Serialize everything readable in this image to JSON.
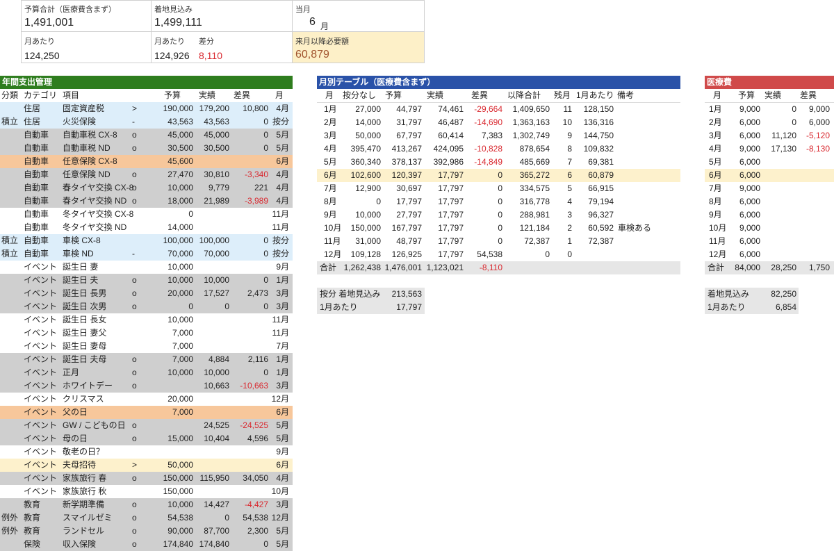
{
  "summary": {
    "budget_label": "予算合計（医療費含まず）",
    "budget_value": "1,491,001",
    "expected_label": "着地見込み",
    "expected_value": "1,499,111",
    "month_label": "当月",
    "month_value": "6",
    "month_unit": "月",
    "per_month_label": "月あたり",
    "per_month_value": "124,250",
    "per_month_label2": "月あたり",
    "diff_label": "差分",
    "per_month_value2": "124,926",
    "diff_value": "8,110",
    "next_label": "来月以降必要額",
    "next_value": "60,879"
  },
  "annual": {
    "title": "年間支出管理",
    "headers": [
      "分類",
      "カテゴリ",
      "項目",
      "",
      "予算",
      "実績",
      "差異",
      "月"
    ],
    "rows": [
      {
        "bg": "blue",
        "cls": "",
        "cat": "住居",
        "item": "固定資産税",
        "flag": ">",
        "budget": "190,000",
        "actual": "179,200",
        "diff": "10,800",
        "month": "4月",
        "neg": false
      },
      {
        "bg": "blue",
        "cls": "積立",
        "cat": "住居",
        "item": "火災保険",
        "flag": "-",
        "budget": "43,563",
        "actual": "43,563",
        "diff": "0",
        "month": "按分",
        "neg": false
      },
      {
        "bg": "gray",
        "cls": "",
        "cat": "自動車",
        "item": "自動車税 CX-8",
        "flag": "o",
        "budget": "45,000",
        "actual": "45,000",
        "diff": "0",
        "month": "5月",
        "neg": false
      },
      {
        "bg": "gray",
        "cls": "",
        "cat": "自動車",
        "item": "自動車税 ND",
        "flag": "o",
        "budget": "30,500",
        "actual": "30,500",
        "diff": "0",
        "month": "5月",
        "neg": false
      },
      {
        "bg": "orange",
        "cls": "",
        "cat": "自動車",
        "item": "任意保険 CX-8",
        "flag": "",
        "budget": "45,600",
        "actual": "",
        "diff": "",
        "month": "6月",
        "neg": false
      },
      {
        "bg": "gray",
        "cls": "",
        "cat": "自動車",
        "item": "任意保険 ND",
        "flag": "o",
        "budget": "27,470",
        "actual": "30,810",
        "diff": "-3,340",
        "month": "4月",
        "neg": true
      },
      {
        "bg": "gray",
        "cls": "",
        "cat": "自動車",
        "item": "春タイヤ交換 CX-8",
        "flag": "o",
        "budget": "10,000",
        "actual": "9,779",
        "diff": "221",
        "month": "4月",
        "neg": false
      },
      {
        "bg": "gray",
        "cls": "",
        "cat": "自動車",
        "item": "春タイヤ交換 ND",
        "flag": "o",
        "budget": "18,000",
        "actual": "21,989",
        "diff": "-3,989",
        "month": "4月",
        "neg": true
      },
      {
        "bg": "white",
        "cls": "",
        "cat": "自動車",
        "item": "冬タイヤ交換 CX-8",
        "flag": "",
        "budget": "0",
        "actual": "",
        "diff": "",
        "month": "11月",
        "neg": false
      },
      {
        "bg": "white",
        "cls": "",
        "cat": "自動車",
        "item": "冬タイヤ交換 ND",
        "flag": "",
        "budget": "14,000",
        "actual": "",
        "diff": "",
        "month": "11月",
        "neg": false
      },
      {
        "bg": "blue",
        "cls": "積立",
        "cat": "自動車",
        "item": "車検 CX-8",
        "flag": "",
        "budget": "100,000",
        "actual": "100,000",
        "diff": "0",
        "month": "按分",
        "neg": false
      },
      {
        "bg": "blue",
        "cls": "積立",
        "cat": "自動車",
        "item": "車検 ND",
        "flag": "-",
        "budget": "70,000",
        "actual": "70,000",
        "diff": "0",
        "month": "按分",
        "neg": false
      },
      {
        "bg": "white",
        "cls": "",
        "cat": "イベント",
        "item": "誕生日 妻",
        "flag": "",
        "budget": "10,000",
        "actual": "",
        "diff": "",
        "month": "9月",
        "neg": false
      },
      {
        "bg": "gray",
        "cls": "",
        "cat": "イベント",
        "item": "誕生日 夫",
        "flag": "o",
        "budget": "10,000",
        "actual": "10,000",
        "diff": "0",
        "month": "1月",
        "neg": false
      },
      {
        "bg": "gray",
        "cls": "",
        "cat": "イベント",
        "item": "誕生日 長男",
        "flag": "o",
        "budget": "20,000",
        "actual": "17,527",
        "diff": "2,473",
        "month": "3月",
        "neg": false
      },
      {
        "bg": "gray",
        "cls": "",
        "cat": "イベント",
        "item": "誕生日 次男",
        "flag": "o",
        "budget": "0",
        "actual": "0",
        "diff": "0",
        "month": "3月",
        "neg": false
      },
      {
        "bg": "white",
        "cls": "",
        "cat": "イベント",
        "item": "誕生日 長女",
        "flag": "",
        "budget": "10,000",
        "actual": "",
        "diff": "",
        "month": "11月",
        "neg": false
      },
      {
        "bg": "white",
        "cls": "",
        "cat": "イベント",
        "item": "誕生日 妻父",
        "flag": "",
        "budget": "7,000",
        "actual": "",
        "diff": "",
        "month": "11月",
        "neg": false
      },
      {
        "bg": "white",
        "cls": "",
        "cat": "イベント",
        "item": "誕生日 妻母",
        "flag": "",
        "budget": "7,000",
        "actual": "",
        "diff": "",
        "month": "7月",
        "neg": false
      },
      {
        "bg": "gray",
        "cls": "",
        "cat": "イベント",
        "item": "誕生日 夫母",
        "flag": "o",
        "budget": "7,000",
        "actual": "4,884",
        "diff": "2,116",
        "month": "1月",
        "neg": false
      },
      {
        "bg": "gray",
        "cls": "",
        "cat": "イベント",
        "item": "正月",
        "flag": "o",
        "budget": "10,000",
        "actual": "10,000",
        "diff": "0",
        "month": "1月",
        "neg": false
      },
      {
        "bg": "gray",
        "cls": "",
        "cat": "イベント",
        "item": "ホワイトデー",
        "flag": "o",
        "budget": "",
        "actual": "10,663",
        "diff": "-10,663",
        "month": "3月",
        "neg": true
      },
      {
        "bg": "white",
        "cls": "",
        "cat": "イベント",
        "item": "クリスマス",
        "flag": "",
        "budget": "20,000",
        "actual": "",
        "diff": "",
        "month": "12月",
        "neg": false
      },
      {
        "bg": "orange",
        "cls": "",
        "cat": "イベント",
        "item": "父の日",
        "flag": "",
        "budget": "7,000",
        "actual": "",
        "diff": "",
        "month": "6月",
        "neg": false
      },
      {
        "bg": "gray",
        "cls": "",
        "cat": "イベント",
        "item": "GW / こどもの日",
        "flag": "o",
        "budget": "",
        "actual": "24,525",
        "diff": "-24,525",
        "month": "5月",
        "neg": true
      },
      {
        "bg": "gray",
        "cls": "",
        "cat": "イベント",
        "item": "母の日",
        "flag": "o",
        "budget": "15,000",
        "actual": "10,404",
        "diff": "4,596",
        "month": "5月",
        "neg": false
      },
      {
        "bg": "white",
        "cls": "",
        "cat": "イベント",
        "item": "敬老の日？",
        "flag": "",
        "budget": "",
        "actual": "",
        "diff": "",
        "month": "9月",
        "neg": false
      },
      {
        "bg": "yellow",
        "cls": "",
        "cat": "イベント",
        "item": "夫母招待",
        "flag": ">",
        "budget": "50,000",
        "actual": "",
        "diff": "",
        "month": "6月",
        "neg": false
      },
      {
        "bg": "gray",
        "cls": "",
        "cat": "イベント",
        "item": "家族旅行 春",
        "flag": "o",
        "budget": "150,000",
        "actual": "115,950",
        "diff": "34,050",
        "month": "4月",
        "neg": false
      },
      {
        "bg": "white",
        "cls": "",
        "cat": "イベント",
        "item": "家族旅行 秋",
        "flag": "",
        "budget": "150,000",
        "actual": "",
        "diff": "",
        "month": "10月",
        "neg": false
      },
      {
        "bg": "gray",
        "cls": "",
        "cat": "教育",
        "item": "新学期準備",
        "flag": "o",
        "budget": "10,000",
        "actual": "14,427",
        "diff": "-4,427",
        "month": "3月",
        "neg": true
      },
      {
        "bg": "gray",
        "cls": "例外",
        "cat": "教育",
        "item": "スマイルゼミ",
        "flag": "o",
        "budget": "54,538",
        "actual": "0",
        "diff": "54,538",
        "month": "12月",
        "neg": false
      },
      {
        "bg": "gray",
        "cls": "例外",
        "cat": "教育",
        "item": "ランドセル",
        "flag": "o",
        "budget": "90,000",
        "actual": "87,700",
        "diff": "2,300",
        "month": "5月",
        "neg": false
      },
      {
        "bg": "gray",
        "cls": "",
        "cat": "保険",
        "item": "収入保険",
        "flag": "o",
        "budget": "174,840",
        "actual": "174,840",
        "diff": "0",
        "month": "5月",
        "neg": false
      }
    ]
  },
  "monthly": {
    "title": "月別テーブル（医療費含まず）",
    "headers": [
      "月",
      "按分なし",
      "予算",
      "実績",
      "差異",
      "以降合計",
      "残月",
      "1月あたり",
      "備考"
    ],
    "rows": [
      {
        "hl": false,
        "m": "1月",
        "a": "27,000",
        "b": "44,797",
        "c": "74,461",
        "d": "-29,664",
        "e": "1,409,650",
        "f": "11",
        "g": "128,150",
        "h": "",
        "neg": true
      },
      {
        "hl": false,
        "m": "2月",
        "a": "14,000",
        "b": "31,797",
        "c": "46,487",
        "d": "-14,690",
        "e": "1,363,163",
        "f": "10",
        "g": "136,316",
        "h": "",
        "neg": true
      },
      {
        "hl": false,
        "m": "3月",
        "a": "50,000",
        "b": "67,797",
        "c": "60,414",
        "d": "7,383",
        "e": "1,302,749",
        "f": "9",
        "g": "144,750",
        "h": "",
        "neg": false
      },
      {
        "hl": false,
        "m": "4月",
        "a": "395,470",
        "b": "413,267",
        "c": "424,095",
        "d": "-10,828",
        "e": "878,654",
        "f": "8",
        "g": "109,832",
        "h": "",
        "neg": true
      },
      {
        "hl": false,
        "m": "5月",
        "a": "360,340",
        "b": "378,137",
        "c": "392,986",
        "d": "-14,849",
        "e": "485,669",
        "f": "7",
        "g": "69,381",
        "h": "",
        "neg": true
      },
      {
        "hl": true,
        "m": "6月",
        "a": "102,600",
        "b": "120,397",
        "c": "17,797",
        "d": "0",
        "e": "365,272",
        "f": "6",
        "g": "60,879",
        "h": "",
        "neg": false
      },
      {
        "hl": false,
        "m": "7月",
        "a": "12,900",
        "b": "30,697",
        "c": "17,797",
        "d": "0",
        "e": "334,575",
        "f": "5",
        "g": "66,915",
        "h": "",
        "neg": false
      },
      {
        "hl": false,
        "m": "8月",
        "a": "0",
        "b": "17,797",
        "c": "17,797",
        "d": "0",
        "e": "316,778",
        "f": "4",
        "g": "79,194",
        "h": "",
        "neg": false
      },
      {
        "hl": false,
        "m": "9月",
        "a": "10,000",
        "b": "27,797",
        "c": "17,797",
        "d": "0",
        "e": "288,981",
        "f": "3",
        "g": "96,327",
        "h": "",
        "neg": false
      },
      {
        "hl": false,
        "m": "10月",
        "a": "150,000",
        "b": "167,797",
        "c": "17,797",
        "d": "0",
        "e": "121,184",
        "f": "2",
        "g": "60,592",
        "h": "車検ある",
        "neg": false
      },
      {
        "hl": false,
        "m": "11月",
        "a": "31,000",
        "b": "48,797",
        "c": "17,797",
        "d": "0",
        "e": "72,387",
        "f": "1",
        "g": "72,387",
        "h": "",
        "neg": false
      },
      {
        "hl": false,
        "m": "12月",
        "a": "109,128",
        "b": "126,925",
        "c": "17,797",
        "d": "54,538",
        "e": "0",
        "f": "0",
        "g": "",
        "h": "",
        "neg": false
      }
    ],
    "total": {
      "label": "合計",
      "a": "1,262,438",
      "b": "1,476,001",
      "c": "1,123,021",
      "d": "-8,110"
    },
    "footer": [
      {
        "label": "按分 着地見込み",
        "value": "213,563"
      },
      {
        "label": "1月あたり",
        "value": "17,797"
      }
    ]
  },
  "medical": {
    "title": "医療費",
    "headers": [
      "月",
      "予算",
      "実績",
      "差異"
    ],
    "rows": [
      {
        "hl": false,
        "m": "1月",
        "a": "9,000",
        "b": "0",
        "c": "9,000",
        "neg": false
      },
      {
        "hl": false,
        "m": "2月",
        "a": "6,000",
        "b": "0",
        "c": "6,000",
        "neg": false
      },
      {
        "hl": false,
        "m": "3月",
        "a": "6,000",
        "b": "11,120",
        "c": "-5,120",
        "neg": true
      },
      {
        "hl": false,
        "m": "4月",
        "a": "9,000",
        "b": "17,130",
        "c": "-8,130",
        "neg": true
      },
      {
        "hl": false,
        "m": "5月",
        "a": "6,000",
        "b": "",
        "c": "",
        "neg": false
      },
      {
        "hl": true,
        "m": "6月",
        "a": "6,000",
        "b": "",
        "c": "",
        "neg": false
      },
      {
        "hl": false,
        "m": "7月",
        "a": "9,000",
        "b": "",
        "c": "",
        "neg": false
      },
      {
        "hl": false,
        "m": "8月",
        "a": "6,000",
        "b": "",
        "c": "",
        "neg": false
      },
      {
        "hl": false,
        "m": "9月",
        "a": "6,000",
        "b": "",
        "c": "",
        "neg": false
      },
      {
        "hl": false,
        "m": "10月",
        "a": "9,000",
        "b": "",
        "c": "",
        "neg": false
      },
      {
        "hl": false,
        "m": "11月",
        "a": "6,000",
        "b": "",
        "c": "",
        "neg": false
      },
      {
        "hl": false,
        "m": "12月",
        "a": "6,000",
        "b": "",
        "c": "",
        "neg": false
      }
    ],
    "total": {
      "label": "合計",
      "a": "84,000",
      "b": "28,250",
      "c": "1,750"
    },
    "footer": [
      {
        "label": "着地見込み",
        "value": "82,250"
      },
      {
        "label": "1月あたり",
        "value": "6,854"
      }
    ]
  },
  "colors": {
    "annual_header": "#2e7d1e",
    "monthly_header": "#2a52a8",
    "medical_header": "#d04a4a",
    "row_blue": "#ddeefa",
    "row_gray": "#cfcfcf",
    "row_orange": "#f7c79b",
    "row_yellow": "#fdf1cc",
    "row_white": "#ffffff",
    "negative": "#d9282f"
  }
}
